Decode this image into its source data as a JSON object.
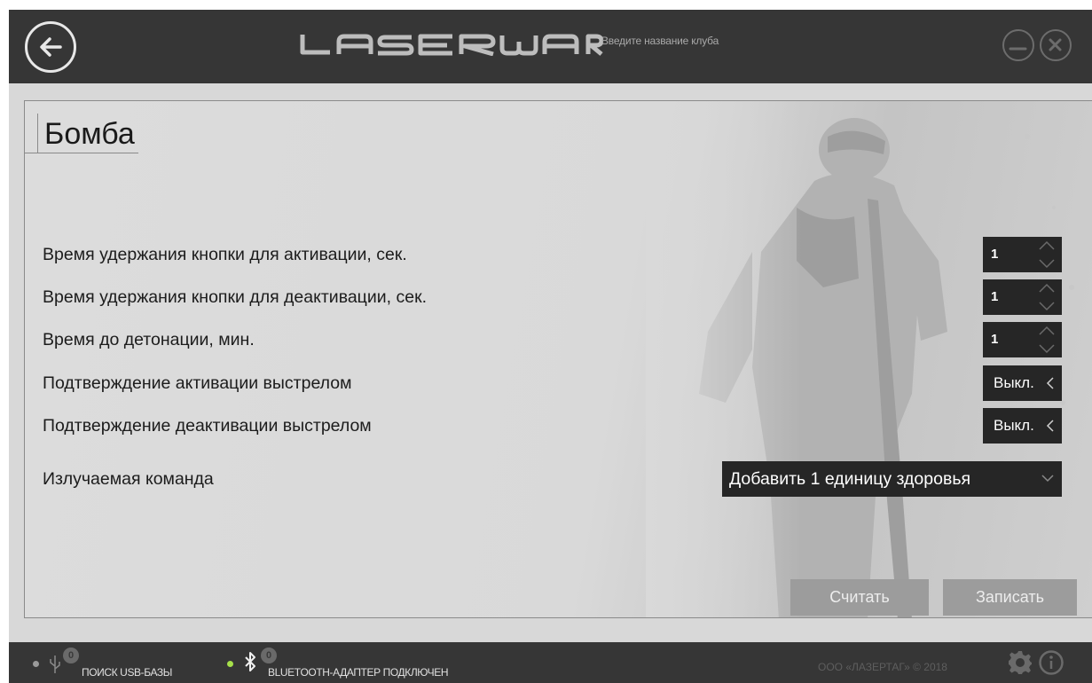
{
  "titlebar": {
    "logo_text": "LASERWAR",
    "club_name_placeholder": "Введите название клуба"
  },
  "page": {
    "title": "Бомба"
  },
  "settings": [
    {
      "label": "Время удержания кнопки для активации, сек.",
      "value": "1",
      "control": "spinner"
    },
    {
      "label": "Время удержания кнопки для деактивации, сек.",
      "value": "1",
      "control": "spinner"
    },
    {
      "label": "Время до детонации, мин.",
      "value": "1",
      "control": "spinner"
    },
    {
      "label": "Подтверждение активации выстрелом",
      "value": "Выкл.",
      "control": "toggle"
    },
    {
      "label": "Подтверждение деактивации выстрелом",
      "value": "Выкл.",
      "control": "toggle"
    },
    {
      "label": "Излучаемая команда",
      "value": "Добавить 1 единицу здоровья",
      "control": "dropdown"
    }
  ],
  "actions": {
    "read_label": "Считать",
    "write_label": "Записать"
  },
  "statusbar": {
    "usb": {
      "count": "0",
      "label": "ПОИСК USB-БАЗЫ",
      "dot_color": "#9a9a9a"
    },
    "bluetooth": {
      "count": "0",
      "label": "BLUETOOTH-АДАПТЕР ПОДКЛЮЧЕН",
      "dot_color": "#a6e04a"
    },
    "copyright": "ООО «ЛАЗЕРТАГ» © 2018"
  },
  "colors": {
    "titlebar_bg": "#363636",
    "control_bg": "#262626",
    "button_bg": "#9c9c9c",
    "content_bg": "#d8d8d8"
  }
}
